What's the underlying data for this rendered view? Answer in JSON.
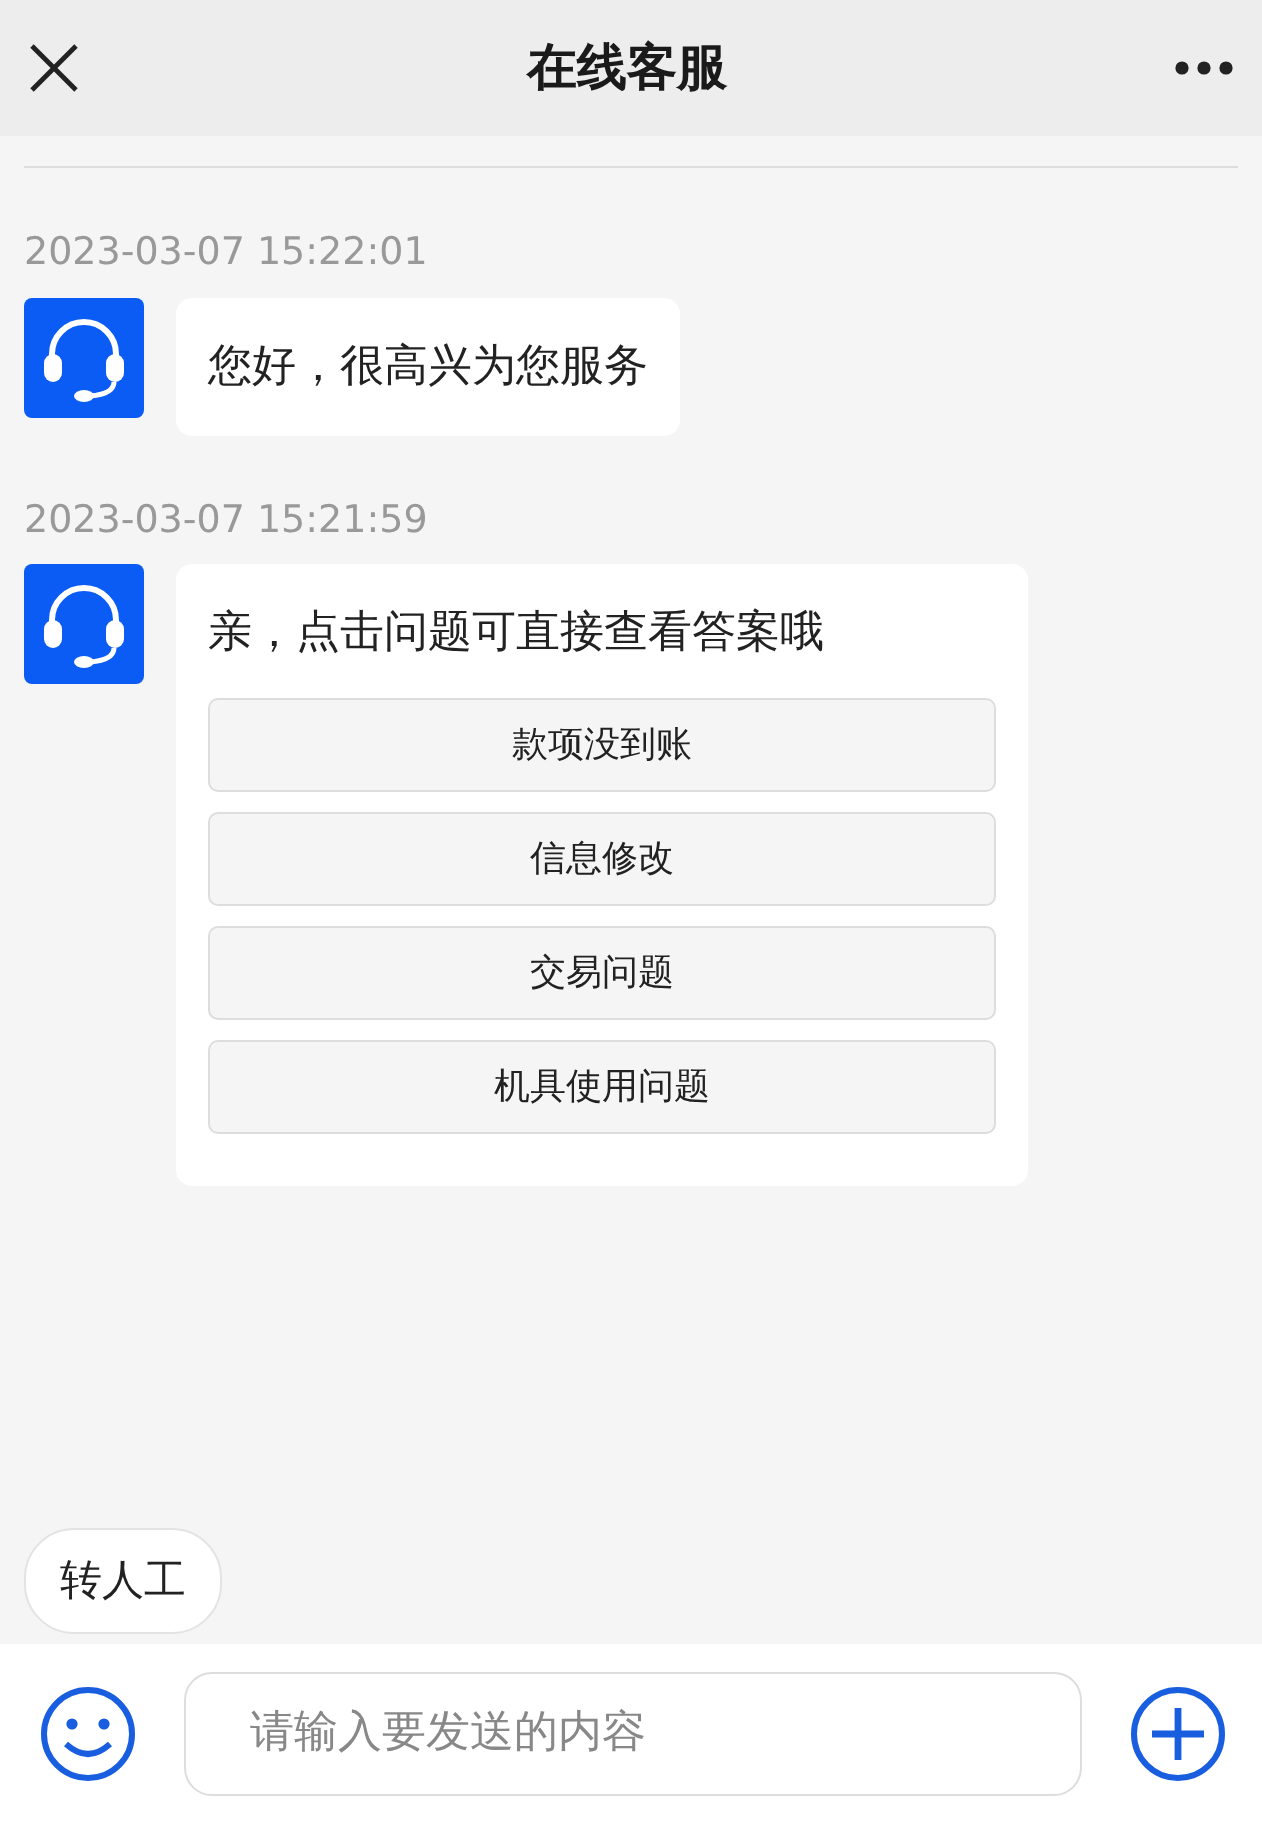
{
  "header": {
    "title": "在线客服"
  },
  "messages": [
    {
      "kind": "text",
      "time": "2023-03-07 15:22:01",
      "text": "您好，很高兴为您服务"
    },
    {
      "kind": "menu",
      "time": "2023-03-07 15:21:59",
      "text": "亲，点击问题可直接查看答案哦",
      "options": [
        "款项没到账",
        "信息修改",
        "交易问题",
        "机具使用问题"
      ]
    }
  ],
  "quick_replies": [
    "转人工"
  ],
  "composer": {
    "placeholder": "请输入要发送的内容"
  }
}
